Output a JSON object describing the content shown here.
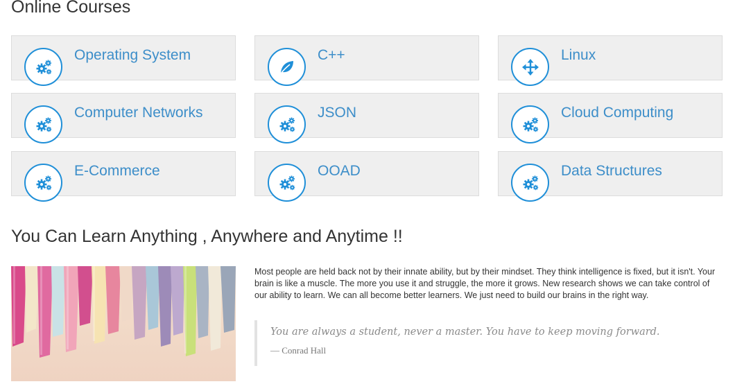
{
  "courses_section": {
    "title": "Online Courses",
    "items": [
      {
        "label": "Operating System",
        "icon": "gears-icon"
      },
      {
        "label": "C++",
        "icon": "leaf-icon"
      },
      {
        "label": "Linux",
        "icon": "move-arrows-icon"
      },
      {
        "label": "Computer Networks",
        "icon": "gears-icon"
      },
      {
        "label": "JSON",
        "icon": "gears-icon"
      },
      {
        "label": "Cloud Computing",
        "icon": "gears-icon"
      },
      {
        "label": "E-Commerce",
        "icon": "gears-icon"
      },
      {
        "label": "OOAD",
        "icon": "gears-icon"
      },
      {
        "label": "Data Structures",
        "icon": "gears-icon"
      }
    ]
  },
  "learn_section": {
    "title": "You Can Learn Anything , Anywhere and Anytime !!",
    "paragraph": "Most people are held back not by their innate ability, but by their mindset. They think intelligence is fixed, but it isn't. Your brain is like a muscle. The more you use it and struggle, the more it grows. New research shows we can take control of our ability to learn. We can all become better learners. We just need to build our brains in the right way.",
    "quote": {
      "text": "You are always a student, never a master. You have to keep moving forward.",
      "author": "— Conrad Hall"
    },
    "image": {
      "icon": "books-image"
    }
  },
  "colors": {
    "accent_blue": "#1f8fd8",
    "label_blue": "#3d8ec9",
    "card_bg": "#efefef"
  }
}
